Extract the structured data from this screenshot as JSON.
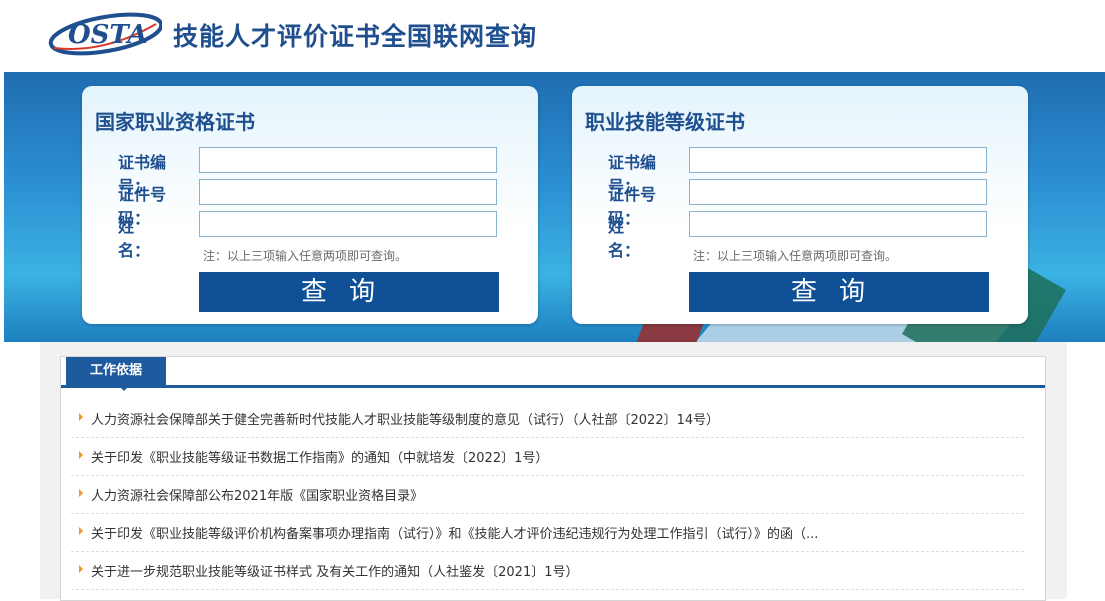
{
  "header": {
    "logo_text": "OSTA",
    "title": "技能人才评价证书全国联网查询"
  },
  "panels": [
    {
      "title": "国家职业资格证书",
      "fields": [
        {
          "label": "证书编号：",
          "value": ""
        },
        {
          "label": "证件号码：",
          "value": ""
        },
        {
          "label": "姓　　名：",
          "value": ""
        }
      ],
      "note": "注：以上三项输入任意两项即可查询。",
      "button": "查询"
    },
    {
      "title": "职业技能等级证书",
      "fields": [
        {
          "label": "证书编号：",
          "value": ""
        },
        {
          "label": "证件号码：",
          "value": ""
        },
        {
          "label": "姓　　名：",
          "value": ""
        }
      ],
      "note": "注：以上三项输入任意两项即可查询。",
      "button": "查询"
    }
  ],
  "work_basis": {
    "tab_label": "工作依据",
    "items": [
      "人力资源社会保障部关于健全完善新时代技能人才职业技能等级制度的意见（试行）（人社部〔2022〕14号）",
      "关于印发《职业技能等级证书数据工作指南》的通知（中就培发〔2022〕1号）",
      "人力资源社会保障部公布2021年版《国家职业资格目录》",
      "关于印发《职业技能等级评价机构备案事项办理指南（试行）》和《技能人才评价违纪违规行为处理工作指引（试行）》的函（...",
      "关于进一步规范职业技能等级证书样式 及有关工作的通知（人社鉴发〔2021〕1号）"
    ]
  },
  "colors": {
    "brand_blue": "#1f4f8f",
    "button_blue": "#0e4f95",
    "bullet_orange": "#e89a2c"
  }
}
